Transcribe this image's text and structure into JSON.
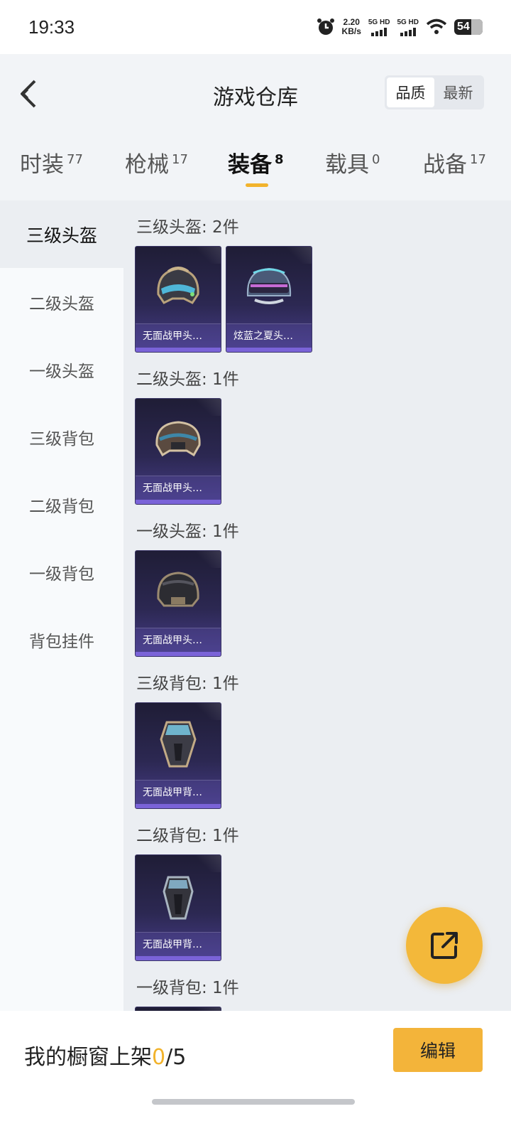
{
  "status_bar": {
    "time": "19:33",
    "net_speed_value": "2.20",
    "net_speed_unit": "KB/s",
    "sim1_label": "5G HD",
    "sim2_label": "5G HD",
    "battery": "54",
    "icons": [
      "alarm-icon",
      "signal-icon",
      "wifi-icon",
      "battery-icon"
    ]
  },
  "header": {
    "title": "游戏仓库",
    "sort_options": [
      "品质",
      "最新"
    ],
    "sort_selected": "品质"
  },
  "tabs": [
    {
      "label": "时装",
      "count": "77"
    },
    {
      "label": "枪械",
      "count": "17"
    },
    {
      "label": "装备",
      "count": "8",
      "active": true
    },
    {
      "label": "载具",
      "count": "0"
    },
    {
      "label": "战备",
      "count": "17"
    }
  ],
  "sidebar": {
    "items": [
      "三级头盔",
      "二级头盔",
      "一级头盔",
      "三级背包",
      "二级背包",
      "一级背包",
      "背包挂件"
    ],
    "selected": "三级头盔"
  },
  "groups": [
    {
      "title": "三级头盔: 2件",
      "items": [
        {
          "name": "无面战甲头…",
          "icon": "helmet-icon"
        },
        {
          "name": "炫蓝之夏头…",
          "icon": "helmet-icon"
        }
      ]
    },
    {
      "title": "二级头盔: 1件",
      "items": [
        {
          "name": "无面战甲头…",
          "icon": "helmet-icon"
        }
      ]
    },
    {
      "title": "一级头盔: 1件",
      "items": [
        {
          "name": "无面战甲头…",
          "icon": "helmet-icon"
        }
      ]
    },
    {
      "title": "三级背包: 1件",
      "items": [
        {
          "name": "无面战甲背…",
          "icon": "backpack-icon"
        }
      ]
    },
    {
      "title": "二级背包: 1件",
      "items": [
        {
          "name": "无面战甲背…",
          "icon": "backpack-icon"
        }
      ]
    },
    {
      "title": "一级背包: 1件",
      "items": []
    }
  ],
  "bottom_bar": {
    "showcase_label": "我的橱窗上架",
    "showcase_count": "0",
    "showcase_total": "/5",
    "edit_label": "编辑"
  },
  "colors": {
    "accent": "#f2b32c",
    "card_bg": "#2c2852",
    "card_stripe": "#7a63d8"
  }
}
